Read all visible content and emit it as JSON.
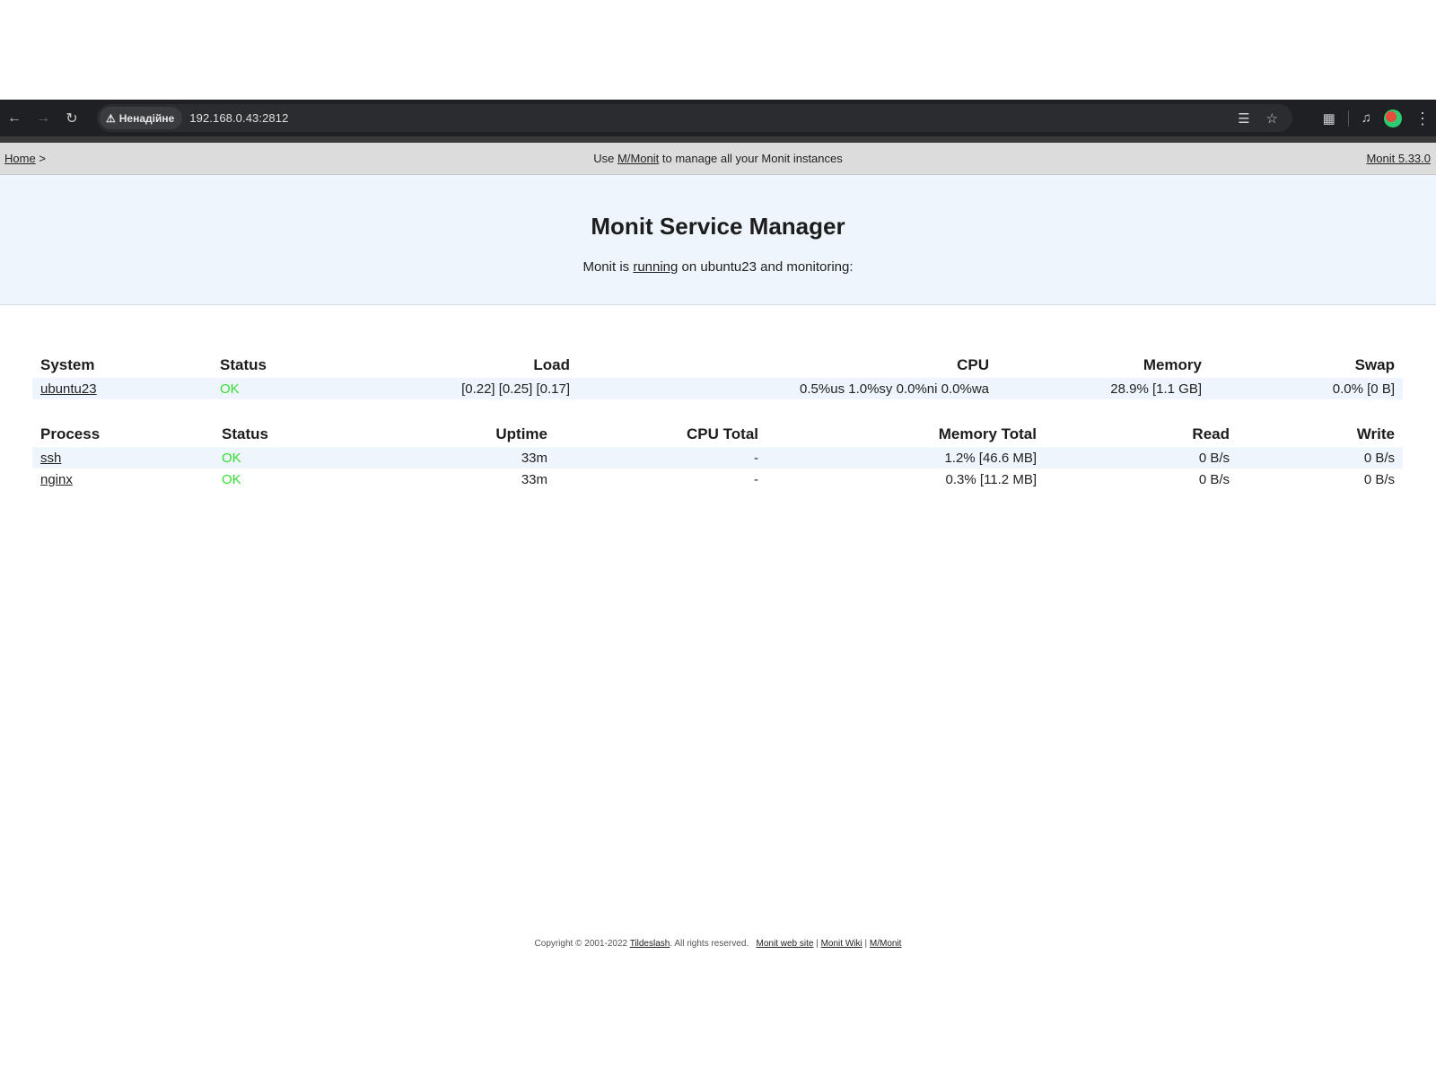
{
  "browser": {
    "security_label": "Ненадійне",
    "url": "192.168.0.43:2812"
  },
  "nav": {
    "home": "Home",
    "home_sep": ">",
    "promo_prefix": "Use",
    "promo_link": "M/Monit",
    "promo_suffix": "to manage all your Monit instances",
    "version": "Monit 5.33.0"
  },
  "header": {
    "title": "Monit Service Manager",
    "status_prefix": "Monit is",
    "status_link": "running",
    "status_suffix": "on ubuntu23 and monitoring:"
  },
  "system_table": {
    "headers": [
      "System",
      "Status",
      "Load",
      "CPU",
      "Memory",
      "Swap"
    ],
    "rows": [
      {
        "name": "ubuntu23",
        "status": "OK",
        "load": "[0.22] [0.25] [0.17]",
        "cpu": "0.5%us 1.0%sy 0.0%ni 0.0%wa",
        "memory": "28.9% [1.1 GB]",
        "swap": "0.0% [0 B]"
      }
    ]
  },
  "process_table": {
    "headers": [
      "Process",
      "Status",
      "Uptime",
      "CPU Total",
      "Memory Total",
      "Read",
      "Write"
    ],
    "rows": [
      {
        "name": "ssh",
        "status": "OK",
        "uptime": "33m",
        "cpu_total": "-",
        "memory_total": "1.2% [46.6 MB]",
        "read": "0 B/s",
        "write": "0 B/s"
      },
      {
        "name": "nginx",
        "status": "OK",
        "uptime": "33m",
        "cpu_total": "-",
        "memory_total": "0.3% [11.2 MB]",
        "read": "0 B/s",
        "write": "0 B/s"
      }
    ]
  },
  "footer": {
    "copyright": "Copyright © 2001-2022",
    "company": "Tildeslash",
    "rights": ". All rights reserved.",
    "link_site": "Monit web site",
    "link_wiki": "Monit Wiki",
    "link_mmonit": "M/Monit",
    "sep": "|"
  },
  "colors": {
    "ok": "#33dd33",
    "header_bg": "#eef5fd",
    "nav_bg": "#dcdcdc",
    "browser_bar": "#1f2023"
  }
}
